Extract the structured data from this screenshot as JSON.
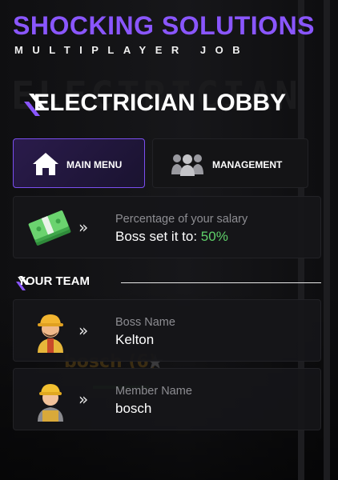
{
  "header": {
    "title": "SHOCKING SOLUTIONS",
    "subtitle": "MULTIPLAYER JOB"
  },
  "background": {
    "watermark": "ELECTRICIAN",
    "ghost_text": "bosch (6)"
  },
  "lobby": {
    "title": "ELECTRICIAN LOBBY"
  },
  "tabs": [
    {
      "label": "MAIN MENU",
      "icon": "house-icon",
      "active": true
    },
    {
      "label": "MANAGEMENT",
      "icon": "group-icon",
      "active": false
    }
  ],
  "salary": {
    "icon": "money-stack-icon",
    "label": "Percentage of your salary",
    "value_prefix": "Boss set it to:",
    "value": "50%"
  },
  "team": {
    "header": "YOUR TEAM",
    "members": [
      {
        "role_label": "Boss Name",
        "name": "Kelton",
        "icon": "boss-worker-icon"
      },
      {
        "role_label": "Member Name",
        "name": "bosch",
        "icon": "member-worker-icon"
      }
    ]
  },
  "colors": {
    "accent": "#8a56ff",
    "green": "#5fd16a",
    "background": "#0b0b0d"
  }
}
